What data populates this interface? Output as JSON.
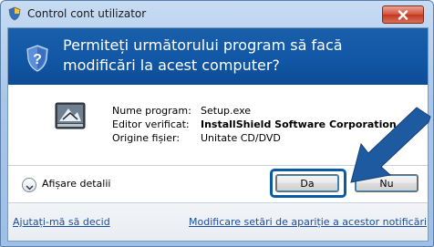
{
  "window": {
    "title": "Control cont utilizator",
    "title_icon": "shield-icon",
    "close_icon": "close-icon"
  },
  "header": {
    "question": "Permiteți următorului program să facă modificări la acest computer?",
    "icon": "uac-shield-question-icon"
  },
  "program": {
    "icon": "setup-program-icon",
    "rows": [
      {
        "key": "Nume program:",
        "value": "Setup.exe",
        "bold": false
      },
      {
        "key": "Editor verificat:",
        "value": "InstallShield Software Corporation",
        "bold": true
      },
      {
        "key": "Origine fișier:",
        "value": "Unitate CD/DVD",
        "bold": false
      }
    ]
  },
  "details_toggle": {
    "label": "Afișare detalii",
    "icon": "chevron-down-icon"
  },
  "buttons": {
    "yes_label": "Da",
    "no_label": "Nu"
  },
  "footer": {
    "help_link": "Ajutați-mă să decid",
    "settings_link": "Modificare setări de apariție a acestor notificări"
  },
  "annotation": {
    "icon": "pointer-arrow-icon",
    "color": "#1e5aa0"
  },
  "colors": {
    "header_blue": "#1157a5",
    "link_blue": "#1c4e9b",
    "close_red": "#c2361f"
  }
}
